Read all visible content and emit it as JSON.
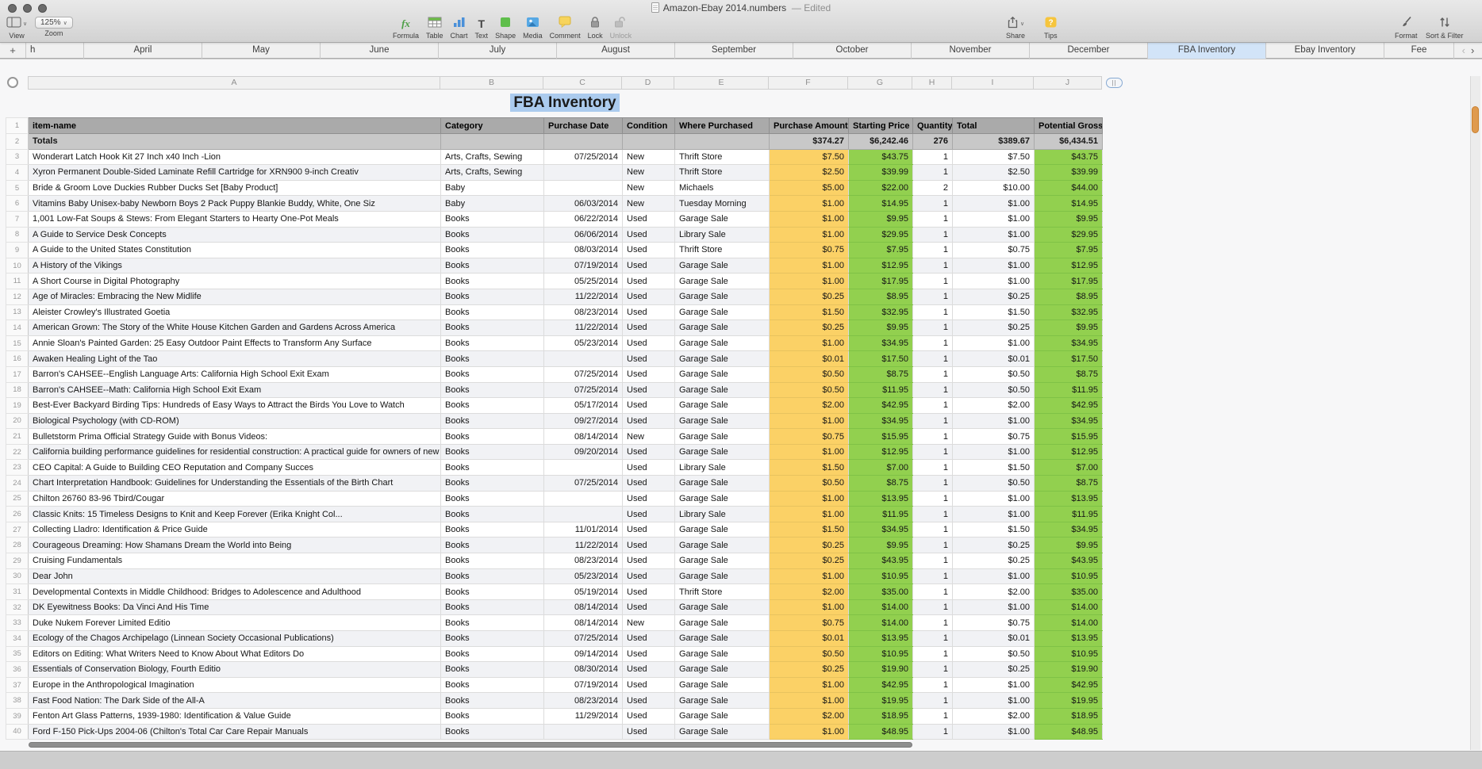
{
  "window": {
    "title": "Amazon-Ebay 2014.numbers",
    "edited": "— Edited"
  },
  "icons": {
    "chevron_down": "∨"
  },
  "toolbar": {
    "view": {
      "label": "View"
    },
    "zoom": {
      "label": "Zoom",
      "value": "125%"
    },
    "buttons": [
      {
        "label": "Formula"
      },
      {
        "label": "Table"
      },
      {
        "label": "Chart"
      },
      {
        "label": "Text"
      },
      {
        "label": "Shape"
      },
      {
        "label": "Media"
      },
      {
        "label": "Comment"
      },
      {
        "label": "Lock"
      },
      {
        "label": "Unlock"
      }
    ],
    "share": {
      "label": "Share"
    },
    "tips": {
      "label": "Tips"
    },
    "format": {
      "label": "Format"
    },
    "sort_filter": {
      "label": "Sort & Filter"
    }
  },
  "tabs": {
    "add": "+",
    "prev": "‹",
    "next": "›",
    "active": "FBA Inventory",
    "items": [
      "h",
      "April",
      "May",
      "June",
      "July",
      "August",
      "September",
      "October",
      "November",
      "December",
      "FBA Inventory",
      "Ebay Inventory",
      "Fee"
    ]
  },
  "sheet": {
    "title": "FBA Inventory",
    "column_letters": [
      "A",
      "B",
      "C",
      "D",
      "E",
      "F",
      "G",
      "H",
      "I",
      "J"
    ],
    "end_handle": "||",
    "columns": [
      "item-name",
      "Category",
      "Purchase Date",
      "Condition",
      "Where Purchased",
      "Purchase Amount",
      "Starting Price",
      "Quantity",
      "Total",
      "Potential Gross"
    ],
    "totals_label": "Totals",
    "totals": {
      "amount": "$374.27",
      "start": "$6,242.46",
      "qty": "276",
      "total": "$389.67",
      "gross": "$6,434.51"
    },
    "rows": [
      [
        "Wonderart Latch Hook Kit 27 Inch x40 Inch -Lion",
        "Arts, Crafts, Sewing",
        "07/25/2014",
        "New",
        "Thrift Store",
        "$7.50",
        "$43.75",
        "1",
        "$7.50",
        "$43.75"
      ],
      [
        "Xyron Permanent Double-Sided Laminate Refill Cartridge for XRN900 9-inch Creativ",
        "Arts, Crafts, Sewing",
        "",
        "New",
        "Thrift Store",
        "$2.50",
        "$39.99",
        "1",
        "$2.50",
        "$39.99"
      ],
      [
        "Bride & Groom Love Duckies Rubber Ducks Set [Baby Product]",
        "Baby",
        "",
        "New",
        "Michaels",
        "$5.00",
        "$22.00",
        "2",
        "$10.00",
        "$44.00"
      ],
      [
        "Vitamins Baby Unisex-baby Newborn Boys 2 Pack Puppy Blankie Buddy, White, One Siz",
        "Baby",
        "06/03/2014",
        "New",
        "Tuesday Morning",
        "$1.00",
        "$14.95",
        "1",
        "$1.00",
        "$14.95"
      ],
      [
        "1,001 Low-Fat Soups & Stews: From Elegant Starters to Hearty One-Pot Meals",
        "Books",
        "06/22/2014",
        "Used",
        "Garage Sale",
        "$1.00",
        "$9.95",
        "1",
        "$1.00",
        "$9.95"
      ],
      [
        "A Guide to Service Desk Concepts",
        "Books",
        "06/06/2014",
        "Used",
        "Library Sale",
        "$1.00",
        "$29.95",
        "1",
        "$1.00",
        "$29.95"
      ],
      [
        "A Guide to the United States Constitution",
        "Books",
        "08/03/2014",
        "Used",
        "Thrift Store",
        "$0.75",
        "$7.95",
        "1",
        "$0.75",
        "$7.95"
      ],
      [
        "A History of the Vikings",
        "Books",
        "07/19/2014",
        "Used",
        "Garage Sale",
        "$1.00",
        "$12.95",
        "1",
        "$1.00",
        "$12.95"
      ],
      [
        "A Short Course in Digital Photography",
        "Books",
        "05/25/2014",
        "Used",
        "Garage Sale",
        "$1.00",
        "$17.95",
        "1",
        "$1.00",
        "$17.95"
      ],
      [
        "Age of Miracles: Embracing the New Midlife",
        "Books",
        "11/22/2014",
        "Used",
        "Garage Sale",
        "$0.25",
        "$8.95",
        "1",
        "$0.25",
        "$8.95"
      ],
      [
        "Aleister Crowley's Illustrated Goetia",
        "Books",
        "08/23/2014",
        "Used",
        "Garage Sale",
        "$1.50",
        "$32.95",
        "1",
        "$1.50",
        "$32.95"
      ],
      [
        "American Grown: The Story of the White House Kitchen Garden and Gardens Across America",
        "Books",
        "11/22/2014",
        "Used",
        "Garage Sale",
        "$0.25",
        "$9.95",
        "1",
        "$0.25",
        "$9.95"
      ],
      [
        "Annie Sloan's Painted Garden: 25 Easy Outdoor Paint Effects to Transform Any Surface",
        "Books",
        "05/23/2014",
        "Used",
        "Garage Sale",
        "$1.00",
        "$34.95",
        "1",
        "$1.00",
        "$34.95"
      ],
      [
        "Awaken Healing Light of the Tao",
        "Books",
        "",
        "Used",
        "Garage Sale",
        "$0.01",
        "$17.50",
        "1",
        "$0.01",
        "$17.50"
      ],
      [
        "Barron's CAHSEE--English Language Arts: California High School Exit Exam",
        "Books",
        "07/25/2014",
        "Used",
        "Garage Sale",
        "$0.50",
        "$8.75",
        "1",
        "$0.50",
        "$8.75"
      ],
      [
        "Barron's CAHSEE--Math: California High School Exit Exam",
        "Books",
        "07/25/2014",
        "Used",
        "Garage Sale",
        "$0.50",
        "$11.95",
        "1",
        "$0.50",
        "$11.95"
      ],
      [
        "Best-Ever Backyard Birding Tips: Hundreds of Easy Ways to Attract the Birds You Love to Watch",
        "Books",
        "05/17/2014",
        "Used",
        "Garage Sale",
        "$2.00",
        "$42.95",
        "1",
        "$2.00",
        "$42.95"
      ],
      [
        "Biological Psychology (with CD-ROM)",
        "Books",
        "09/27/2014",
        "Used",
        "Garage Sale",
        "$1.00",
        "$34.95",
        "1",
        "$1.00",
        "$34.95"
      ],
      [
        "Bulletstorm Prima Official Strategy Guide with Bonus Videos:",
        "Books",
        "08/14/2014",
        "New",
        "Garage Sale",
        "$0.75",
        "$15.95",
        "1",
        "$0.75",
        "$15.95"
      ],
      [
        "California building performance guidelines for residential construction: A practical guide for owners of new homes : constr",
        "Books",
        "09/20/2014",
        "Used",
        "Garage Sale",
        "$1.00",
        "$12.95",
        "1",
        "$1.00",
        "$12.95"
      ],
      [
        "CEO Capital: A Guide to Building CEO Reputation and Company Succes",
        "Books",
        "",
        "Used",
        "Library Sale",
        "$1.50",
        "$7.00",
        "1",
        "$1.50",
        "$7.00"
      ],
      [
        "Chart Interpretation Handbook: Guidelines for Understanding the Essentials of the Birth Chart",
        "Books",
        "07/25/2014",
        "Used",
        "Garage Sale",
        "$0.50",
        "$8.75",
        "1",
        "$0.50",
        "$8.75"
      ],
      [
        "Chilton 26760 83-96 Tbird/Cougar",
        "Books",
        "",
        "Used",
        "Garage Sale",
        "$1.00",
        "$13.95",
        "1",
        "$1.00",
        "$13.95"
      ],
      [
        "Classic Knits: 15 Timeless Designs to Knit and Keep Forever (Erika Knight Col...",
        "Books",
        "",
        "Used",
        "Library Sale",
        "$1.00",
        "$11.95",
        "1",
        "$1.00",
        "$11.95"
      ],
      [
        "Collecting Lladro: Identification & Price Guide",
        "Books",
        "11/01/2014",
        "Used",
        "Garage Sale",
        "$1.50",
        "$34.95",
        "1",
        "$1.50",
        "$34.95"
      ],
      [
        "Courageous Dreaming: How Shamans Dream the World into Being",
        "Books",
        "11/22/2014",
        "Used",
        "Garage Sale",
        "$0.25",
        "$9.95",
        "1",
        "$0.25",
        "$9.95"
      ],
      [
        "Cruising Fundamentals",
        "Books",
        "08/23/2014",
        "Used",
        "Garage Sale",
        "$0.25",
        "$43.95",
        "1",
        "$0.25",
        "$43.95"
      ],
      [
        "Dear John",
        "Books",
        "05/23/2014",
        "Used",
        "Garage Sale",
        "$1.00",
        "$10.95",
        "1",
        "$1.00",
        "$10.95"
      ],
      [
        "Developmental Contexts in Middle Childhood: Bridges to Adolescence and Adulthood",
        "Books",
        "05/19/2014",
        "Used",
        "Thrift Store",
        "$2.00",
        "$35.00",
        "1",
        "$2.00",
        "$35.00"
      ],
      [
        "DK Eyewitness Books: Da Vinci And His Time",
        "Books",
        "08/14/2014",
        "Used",
        "Garage Sale",
        "$1.00",
        "$14.00",
        "1",
        "$1.00",
        "$14.00"
      ],
      [
        "Duke Nukem Forever Limited Editio",
        "Books",
        "08/14/2014",
        "New",
        "Garage Sale",
        "$0.75",
        "$14.00",
        "1",
        "$0.75",
        "$14.00"
      ],
      [
        "Ecology of the Chagos Archipelago (Linnean Society Occasional Publications)",
        "Books",
        "07/25/2014",
        "Used",
        "Garage Sale",
        "$0.01",
        "$13.95",
        "1",
        "$0.01",
        "$13.95"
      ],
      [
        "Editors on Editing: What Writers Need to Know About What Editors Do",
        "Books",
        "09/14/2014",
        "Used",
        "Garage Sale",
        "$0.50",
        "$10.95",
        "1",
        "$0.50",
        "$10.95"
      ],
      [
        "Essentials of Conservation Biology, Fourth Editio",
        "Books",
        "08/30/2014",
        "Used",
        "Garage Sale",
        "$0.25",
        "$19.90",
        "1",
        "$0.25",
        "$19.90"
      ],
      [
        "Europe in the Anthropological Imagination",
        "Books",
        "07/19/2014",
        "Used",
        "Garage Sale",
        "$1.00",
        "$42.95",
        "1",
        "$1.00",
        "$42.95"
      ],
      [
        "Fast Food Nation: The Dark Side of the All-A",
        "Books",
        "08/23/2014",
        "Used",
        "Garage Sale",
        "$1.00",
        "$19.95",
        "1",
        "$1.00",
        "$19.95"
      ],
      [
        "Fenton Art Glass Patterns, 1939-1980: Identification & Value Guide",
        "Books",
        "11/29/2014",
        "Used",
        "Garage Sale",
        "$2.00",
        "$18.95",
        "1",
        "$2.00",
        "$18.95"
      ],
      [
        "Ford F-150 Pick-Ups 2004-06 (Chilton's Total Car Care Repair Manuals",
        "Books",
        "",
        "Used",
        "Garage Sale",
        "$1.00",
        "$48.95",
        "1",
        "$1.00",
        "$48.95"
      ]
    ]
  }
}
